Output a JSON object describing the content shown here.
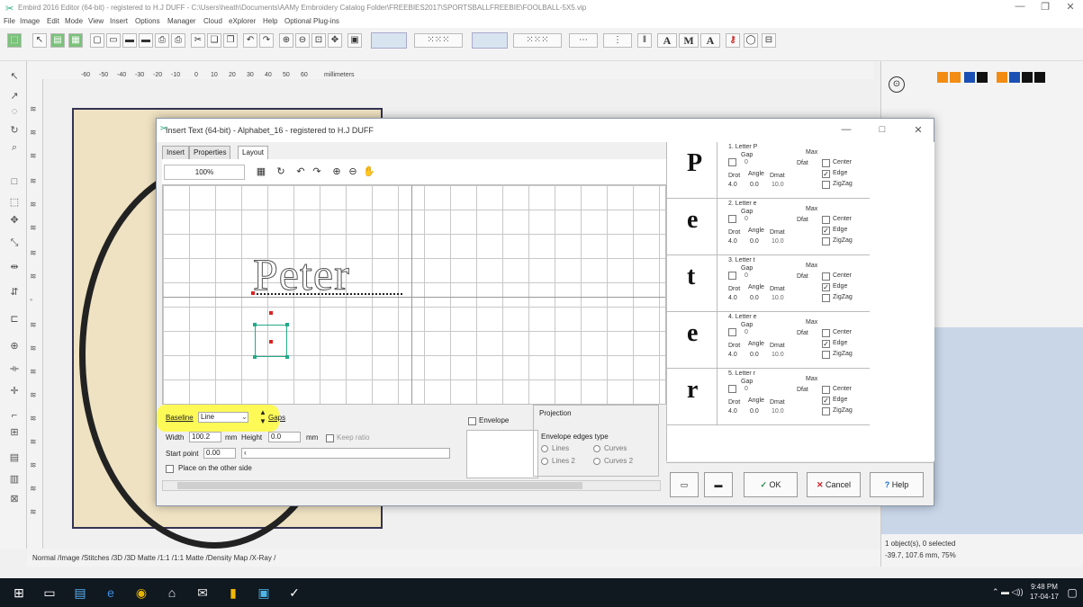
{
  "app": {
    "title": "Embird 2016 Editor (64-bit) - registered to H.J DUFF - C:\\Users\\heath\\Documents\\AAMy Embroidery Catalog Folder\\FREEBIES2017\\SPORTSBALLFREEBIE\\FOOLBALL-5X5.vip",
    "menu": [
      "File",
      "Image",
      "Edit",
      "Mode",
      "View",
      "Insert",
      "Options",
      "Manager",
      "Cloud",
      "eXplorer",
      "Help",
      "Optional Plug-ins"
    ]
  },
  "ruler": {
    "ticks": [
      "-60",
      "-50",
      "-40",
      "-30",
      "-20",
      "-10",
      "0",
      "10",
      "20",
      "30",
      "40",
      "50",
      "60"
    ],
    "unit": "millimeters"
  },
  "view_tabs": "Normal /Image /Stitches /3D /3D Matte /1:1 /1:1 Matte /Density Map /X-Ray /",
  "status": {
    "selection": "1 object(s), 0 selected",
    "coords": "-39.7, 107.6 mm, 75%"
  },
  "taskbar": {
    "time": "9:48 PM",
    "date": "17-04-17"
  },
  "dialog": {
    "title": "Insert Text (64-bit) - Alphabet_16 - registered to H.J DUFF",
    "tabs": [
      "Insert",
      "Properties",
      "Layout"
    ],
    "zoom": "100%",
    "preview_text": "Peter",
    "settings": {
      "baseline_label": "Baseline",
      "baseline_value": "Line",
      "gaps_label": "Gaps",
      "width_label": "Width",
      "width_value": "100.2",
      "width_unit": "mm",
      "height_label": "Height",
      "height_value": "0.0",
      "height_unit": "mm",
      "keep_ratio_label": "Keep ratio",
      "start_point_label": "Start point",
      "start_point_value": "0.00",
      "place_other_side_label": "Place on the other side",
      "envelope_label": "Envelope",
      "projection_label": "Projection",
      "envelope_edges_label": "Envelope edges type",
      "edge_options": [
        "Lines",
        "Curves",
        "Lines 2",
        "Curves 2"
      ]
    },
    "letters": [
      {
        "header": "1. Letter P",
        "glyph": "P"
      },
      {
        "header": "2. Letter e",
        "glyph": "e"
      },
      {
        "header": "3. Letter t",
        "glyph": "t"
      },
      {
        "header": "4. Letter e",
        "glyph": "e"
      },
      {
        "header": "5. Letter r",
        "glyph": "r"
      }
    ],
    "letter_fields": {
      "gap": "Gap",
      "gap_value": "0",
      "drot": "Drot",
      "drot_value": "4.0",
      "angle": "Angle",
      "angle_value": "0.0",
      "dmat": "Dmat",
      "dmat_value": "10.0",
      "max": "Max",
      "dfat": "Dfat",
      "center": "Center",
      "edge": "Edge",
      "zigzag": "ZigZag"
    },
    "buttons": {
      "ok": "OK",
      "cancel": "Cancel",
      "help": "Help"
    }
  },
  "colors": {
    "accent": "#2a8a4a",
    "highlight": "#fffa3c",
    "hoop_fill": "#efe2c2"
  }
}
